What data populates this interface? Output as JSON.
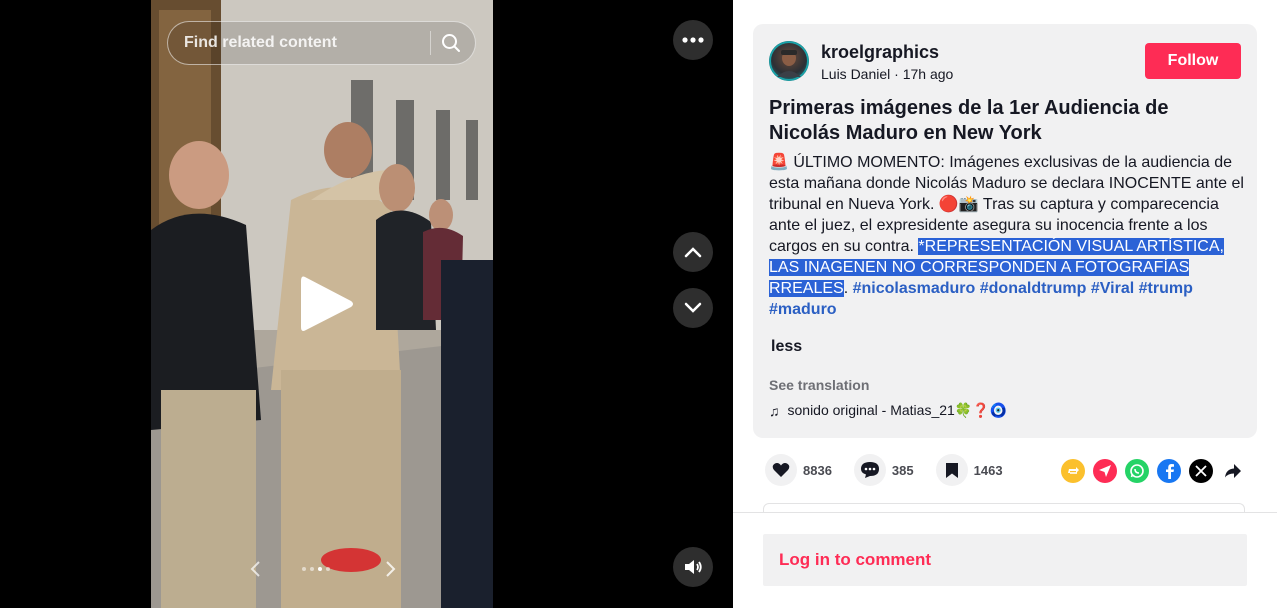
{
  "video": {
    "search_placeholder": "Find related content",
    "slide_count": 4,
    "active_slide": 3
  },
  "post": {
    "username": "kroelgraphics",
    "display_name": "Luis Daniel",
    "separator": " · ",
    "time_ago": "17h ago",
    "follow_label": "Follow",
    "title": "Primeras imágenes de la 1er Audiencia de Nicolás Maduro en New York",
    "desc_alarm": "🚨",
    "desc_text": " ÚLTIMO MOMENTO: Imágenes exclusivas de la audiencia de esta mañana donde Nicolás Maduro se declara INOCENTE ante el tribunal en Nueva York. 🔴📸 Tras su captura y comparecencia ante el juez, el expresidente asegura su inocencia frente a los cargos en su contra. ",
    "desc_selected": "*REPRESENTACIÓN VISUAL ARTÍSTICA, LAS INAGENEN NO CORRESPONDEN A FOTOGRAFÍAS RREALES",
    "desc_after": ". ",
    "hashtags": [
      "#nicolasmaduro",
      "#donaldtrump",
      "#Viral",
      "#trump",
      "#maduro"
    ],
    "less_label": "less",
    "see_translation": "See translation",
    "music_note": "♫",
    "music": "sonido original - Matias_21🍀❓🧿"
  },
  "actions": {
    "likes": "8836",
    "comments": "385",
    "saves": "1463"
  },
  "share_icons": [
    "repost-icon",
    "send-icon",
    "whatsapp-icon",
    "facebook-icon",
    "x-icon",
    "share-arrow-icon"
  ],
  "colors": {
    "accent": "#fe2c55",
    "selection": "#2b62d6",
    "hashtag": "#2b5fc3",
    "whatsapp": "#25d366",
    "facebook": "#1877f2",
    "repost": "#fbc02d"
  },
  "comment": {
    "login_label": "Log in to comment"
  }
}
